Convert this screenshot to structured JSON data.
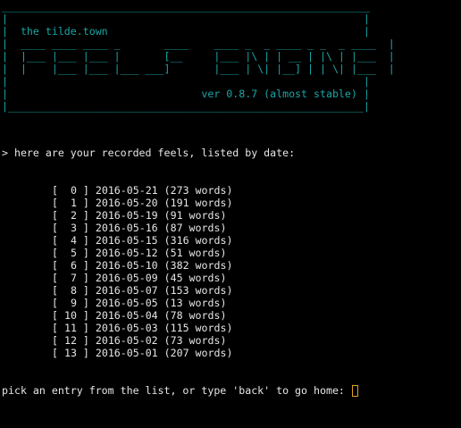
{
  "banner": {
    "lines": [
      "___________________________________________________________",
      "|                                                         |",
      "|  the tilde.town                                         |",
      "|  ____ ____ ____ _       ____    ____ _  _ ____ _ _  _ ____  |",
      "|  |___ |___ |___ |       [__     |___ |\\ | | __ | |\\ | |___  |",
      "|  |    |___ |___ |___ ___]       |___ | \\| |__] | | \\| |___  |",
      "|                                                         |",
      "|                               ver 0.8.7 (almost stable) |",
      "|_________________________________________________________|"
    ],
    "subtitle": "the tilde.town",
    "version": "ver 0.8.7 (almost stable)",
    "colors": {
      "banner": "#19a6a6",
      "text": "#e6e6e6",
      "cursor": "#e0a020",
      "background": "#000000"
    }
  },
  "prompt_header": "> here are your recorded feels, listed by date:",
  "entries": [
    "[  0 ] 2016-05-21 (273 words)",
    "[  1 ] 2016-05-20 (191 words)",
    "[  2 ] 2016-05-19 (91 words)",
    "[  3 ] 2016-05-16 (87 words)",
    "[  4 ] 2016-05-15 (316 words)",
    "[  5 ] 2016-05-12 (51 words)",
    "[  6 ] 2016-05-10 (382 words)",
    "[  7 ] 2016-05-09 (45 words)",
    "[  8 ] 2016-05-07 (153 words)",
    "[  9 ] 2016-05-05 (13 words)",
    "[ 10 ] 2016-05-04 (78 words)",
    "[ 11 ] 2016-05-03 (115 words)",
    "[ 12 ] 2016-05-02 (73 words)",
    "[ 13 ] 2016-05-01 (207 words)"
  ],
  "input_prompt": "pick an entry from the list, or type 'back' to go home: "
}
